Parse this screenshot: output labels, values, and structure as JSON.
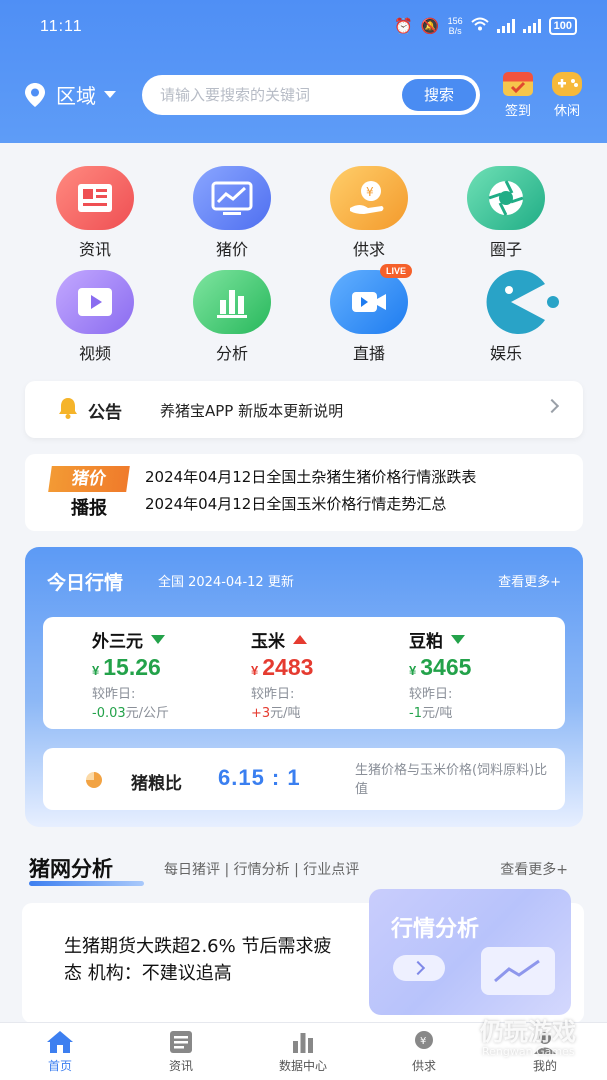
{
  "status_bar": {
    "time": "11:11",
    "net_speed_value": "156",
    "net_speed_unit": "B/s",
    "battery": "100"
  },
  "header": {
    "region_label": "区域",
    "search_placeholder": "请输入要搜索的关键词",
    "search_button": "搜索",
    "checkin_label": "签到",
    "leisure_label": "休闲"
  },
  "grid": [
    {
      "label": "资讯",
      "icon": "news-icon",
      "color": "#f0615f"
    },
    {
      "label": "猪价",
      "icon": "price-chart-icon",
      "color": "#5b7ef3"
    },
    {
      "label": "供求",
      "icon": "supply-icon",
      "color": "#f5a33a"
    },
    {
      "label": "圈子",
      "icon": "circle-shutter-icon",
      "color": "#33c29a"
    },
    {
      "label": "视频",
      "icon": "video-icon",
      "color": "#9b80f2"
    },
    {
      "label": "分析",
      "icon": "analysis-bars-icon",
      "color": "#34c26b"
    },
    {
      "label": "直播",
      "icon": "live-camera-icon",
      "color": "#2f8bf0",
      "badge": "LIVE"
    },
    {
      "label": "娱乐",
      "icon": "pacman-icon",
      "color": "#29a3c7"
    }
  ],
  "notice": {
    "title": "公告",
    "text": "养猪宝APP 新版本更新说明"
  },
  "broadcast": {
    "badge_top": "猪价",
    "badge_bottom": "播报",
    "lines": [
      "2024年04月12日全国土杂猪生猪价格行情涨跌表",
      "2024年04月12日全国玉米价格行情走势汇总"
    ]
  },
  "market": {
    "title": "今日行情",
    "subtitle": "全国 2024-04-12 更新",
    "more": "查看更多+",
    "compare_label": "较昨日:",
    "currency": "¥",
    "items": [
      {
        "name": "外三元",
        "trend": "down",
        "price": "15.26",
        "change": "-0.03",
        "unit": "元/公斤",
        "color": "#23a24a"
      },
      {
        "name": "玉米",
        "trend": "up",
        "price": "2483",
        "change": "+3",
        "unit": "元/吨",
        "color": "#e53b30"
      },
      {
        "name": "豆粕",
        "trend": "down",
        "price": "3465",
        "change": "-1",
        "unit": "元/吨",
        "color": "#23a24a"
      }
    ],
    "ratio": {
      "name": "猪粮比",
      "value": "6.15 : 1",
      "desc": "生猪价格与玉米价格(饲料原料)比值"
    }
  },
  "analysis": {
    "title": "猪网分析",
    "tabs": "每日猪评 | 行情分析 | 行业点评",
    "more": "查看更多+",
    "headline": "生猪期货大跌超2.6% 节后需求疲态 机构：不建议追高",
    "promo_title": "行情分析"
  },
  "tabbar": [
    {
      "label": "首页",
      "icon": "home-icon",
      "active": true
    },
    {
      "label": "资讯",
      "icon": "news-tab-icon",
      "active": false
    },
    {
      "label": "数据中心",
      "icon": "data-center-icon",
      "active": false
    },
    {
      "label": "供求",
      "icon": "supply-tab-icon",
      "active": false
    },
    {
      "label": "我的",
      "icon": "profile-icon",
      "active": false
    }
  ],
  "watermark": {
    "text": "仍玩游戏",
    "sub": "Rengwan Games"
  }
}
